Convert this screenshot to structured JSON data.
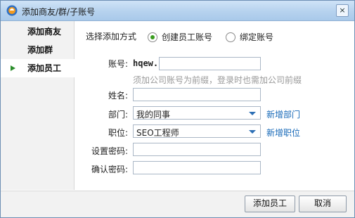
{
  "window": {
    "title": "添加商友/群/子账号",
    "close_label": "×"
  },
  "sidebar": {
    "items": [
      {
        "label": "添加商友"
      },
      {
        "label": "添加群"
      },
      {
        "label": "添加员工"
      }
    ]
  },
  "form": {
    "mode_label": "选择添加方式",
    "mode_options": [
      {
        "label": "创建员工账号",
        "checked": true
      },
      {
        "label": "绑定账号",
        "checked": false
      }
    ],
    "account": {
      "label": "账号:",
      "prefix": "hqew.",
      "value": "",
      "hint": "须加公司账号为前缀，登录时也需加公司前缀"
    },
    "name": {
      "label": "姓名:",
      "value": ""
    },
    "department": {
      "label": "部门:",
      "value": "我的同事",
      "add_link": "新增部门"
    },
    "position": {
      "label": "职位:",
      "value": "SEO工程师",
      "add_link": "新增职位"
    },
    "password": {
      "label": "设置密码:",
      "value": ""
    },
    "confirm_password": {
      "label": "确认密码:",
      "value": ""
    }
  },
  "footer": {
    "submit_label": "添加员工",
    "cancel_label": "取消"
  }
}
